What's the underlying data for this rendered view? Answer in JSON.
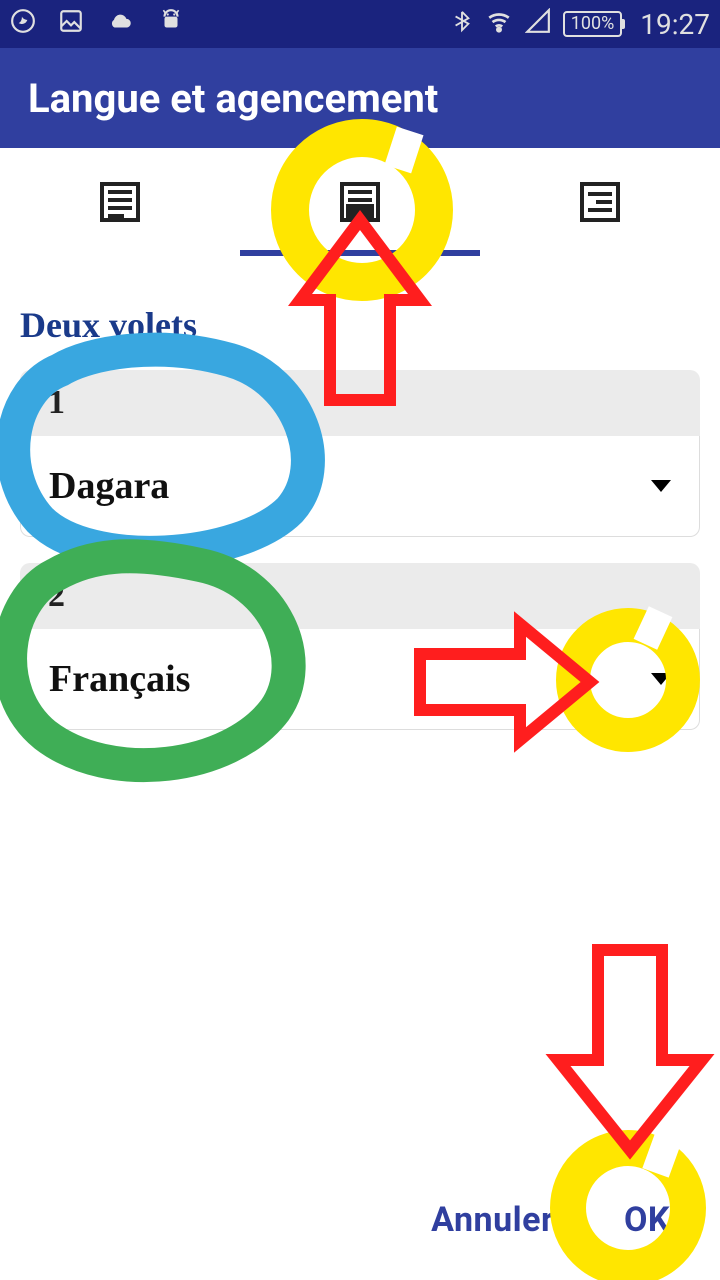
{
  "status": {
    "time": "19:27",
    "battery": "100%"
  },
  "app": {
    "title": "Langue et agencement"
  },
  "tabs": {
    "active_index": 1
  },
  "section": {
    "title": "Deux volets"
  },
  "panes": [
    {
      "num": "1",
      "lang": "Dagara"
    },
    {
      "num": "2",
      "lang": "Français"
    }
  ],
  "footer": {
    "cancel": "Annuler",
    "ok": "OK"
  },
  "annotations": {
    "highlighter_color": "#ffe600",
    "arrow_color": "#ff1e1e",
    "circle_colors": [
      "#39a7e0",
      "#3fae56"
    ]
  }
}
